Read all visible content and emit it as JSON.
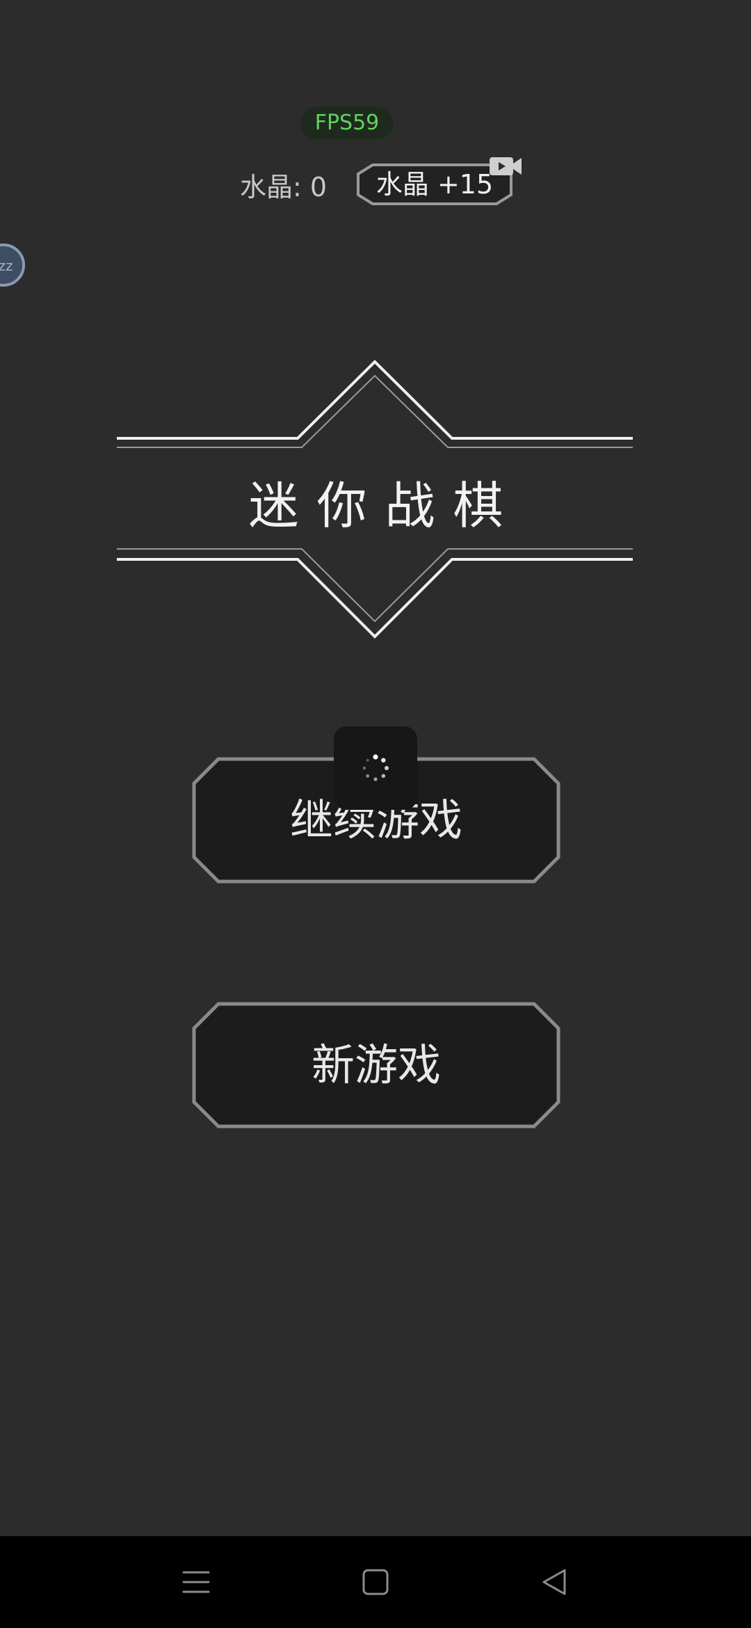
{
  "hud": {
    "fps": "FPS59",
    "crystal_label": "水晶: 0",
    "crystal_reward_button": "水晶 +15",
    "video_icon": "video-camera-icon"
  },
  "title": "迷你战棋",
  "menu": {
    "continue_label": "继续游戏",
    "new_game_label": "新游戏"
  },
  "overlay": {
    "loading_icon": "spinner-icon"
  },
  "navbar": {
    "items": [
      "menu-icon",
      "home-square-icon",
      "back-triangle-icon"
    ]
  },
  "colors": {
    "background": "#2c2c2c",
    "fps_text": "#5fd35f",
    "button_fill": "#1c1c1c",
    "button_border": "#8a8a8a",
    "nav_bar": "#000000"
  }
}
